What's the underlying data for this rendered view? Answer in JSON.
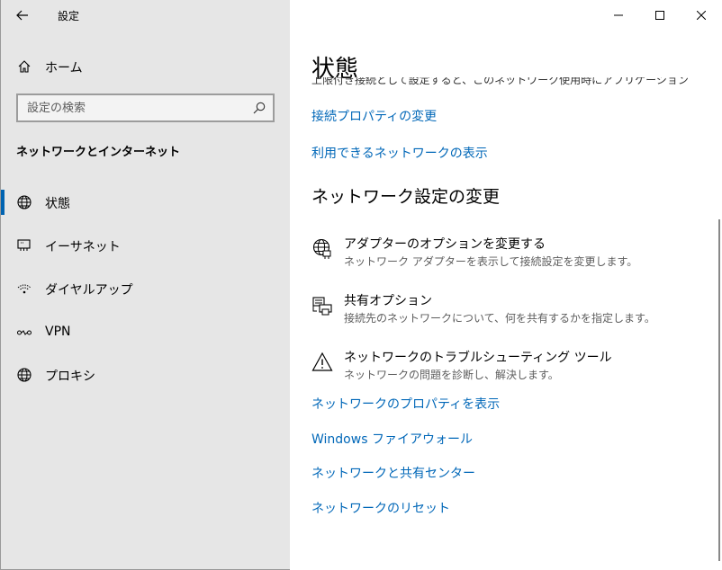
{
  "titlebar": {
    "app_title": "設定",
    "back_icon": "back-arrow-icon"
  },
  "window_controls": {
    "minimize": "—",
    "maximize": "☐",
    "close": "✕"
  },
  "sidebar": {
    "home_label": "ホーム",
    "search_placeholder": "設定の検索",
    "section_title": "ネットワークとインターネット",
    "items": [
      {
        "label": "状態",
        "icon": "globe-icon",
        "active": true
      },
      {
        "label": "イーサネット",
        "icon": "ethernet-icon",
        "active": false
      },
      {
        "label": "ダイヤルアップ",
        "icon": "dialup-icon",
        "active": false
      },
      {
        "label": "VPN",
        "icon": "vpn-icon",
        "active": false
      },
      {
        "label": "プロキシ",
        "icon": "globe-icon",
        "active": false
      }
    ]
  },
  "main": {
    "page_title": "状態",
    "cut_off_text": "上限付き接続として設定すると、このネットワーク使用時にアプリケーションの動作を変更できます。",
    "links_top": [
      "接続プロパティの変更",
      "利用できるネットワークの表示"
    ],
    "section_heading": "ネットワーク設定の変更",
    "options": [
      {
        "title": "アダプターのオプションを変更する",
        "desc": "ネットワーク アダプターを表示して接続設定を変更します。",
        "icon": "adapter-globe-icon"
      },
      {
        "title": "共有オプション",
        "desc": "接続先のネットワークについて、何を共有するかを指定します。",
        "icon": "sharing-printer-icon"
      },
      {
        "title": "ネットワークのトラブルシューティング ツール",
        "desc": "ネットワークの問題を診断し、解決します。",
        "icon": "warning-icon"
      }
    ],
    "links_bottom": [
      "ネットワークのプロパティを表示",
      "Windows ファイアウォール",
      "ネットワークと共有センター",
      "ネットワークのリセット"
    ]
  },
  "colors": {
    "sidebar_bg": "#e6e6e6",
    "link": "#0067b8",
    "accent": "#0063b1"
  }
}
